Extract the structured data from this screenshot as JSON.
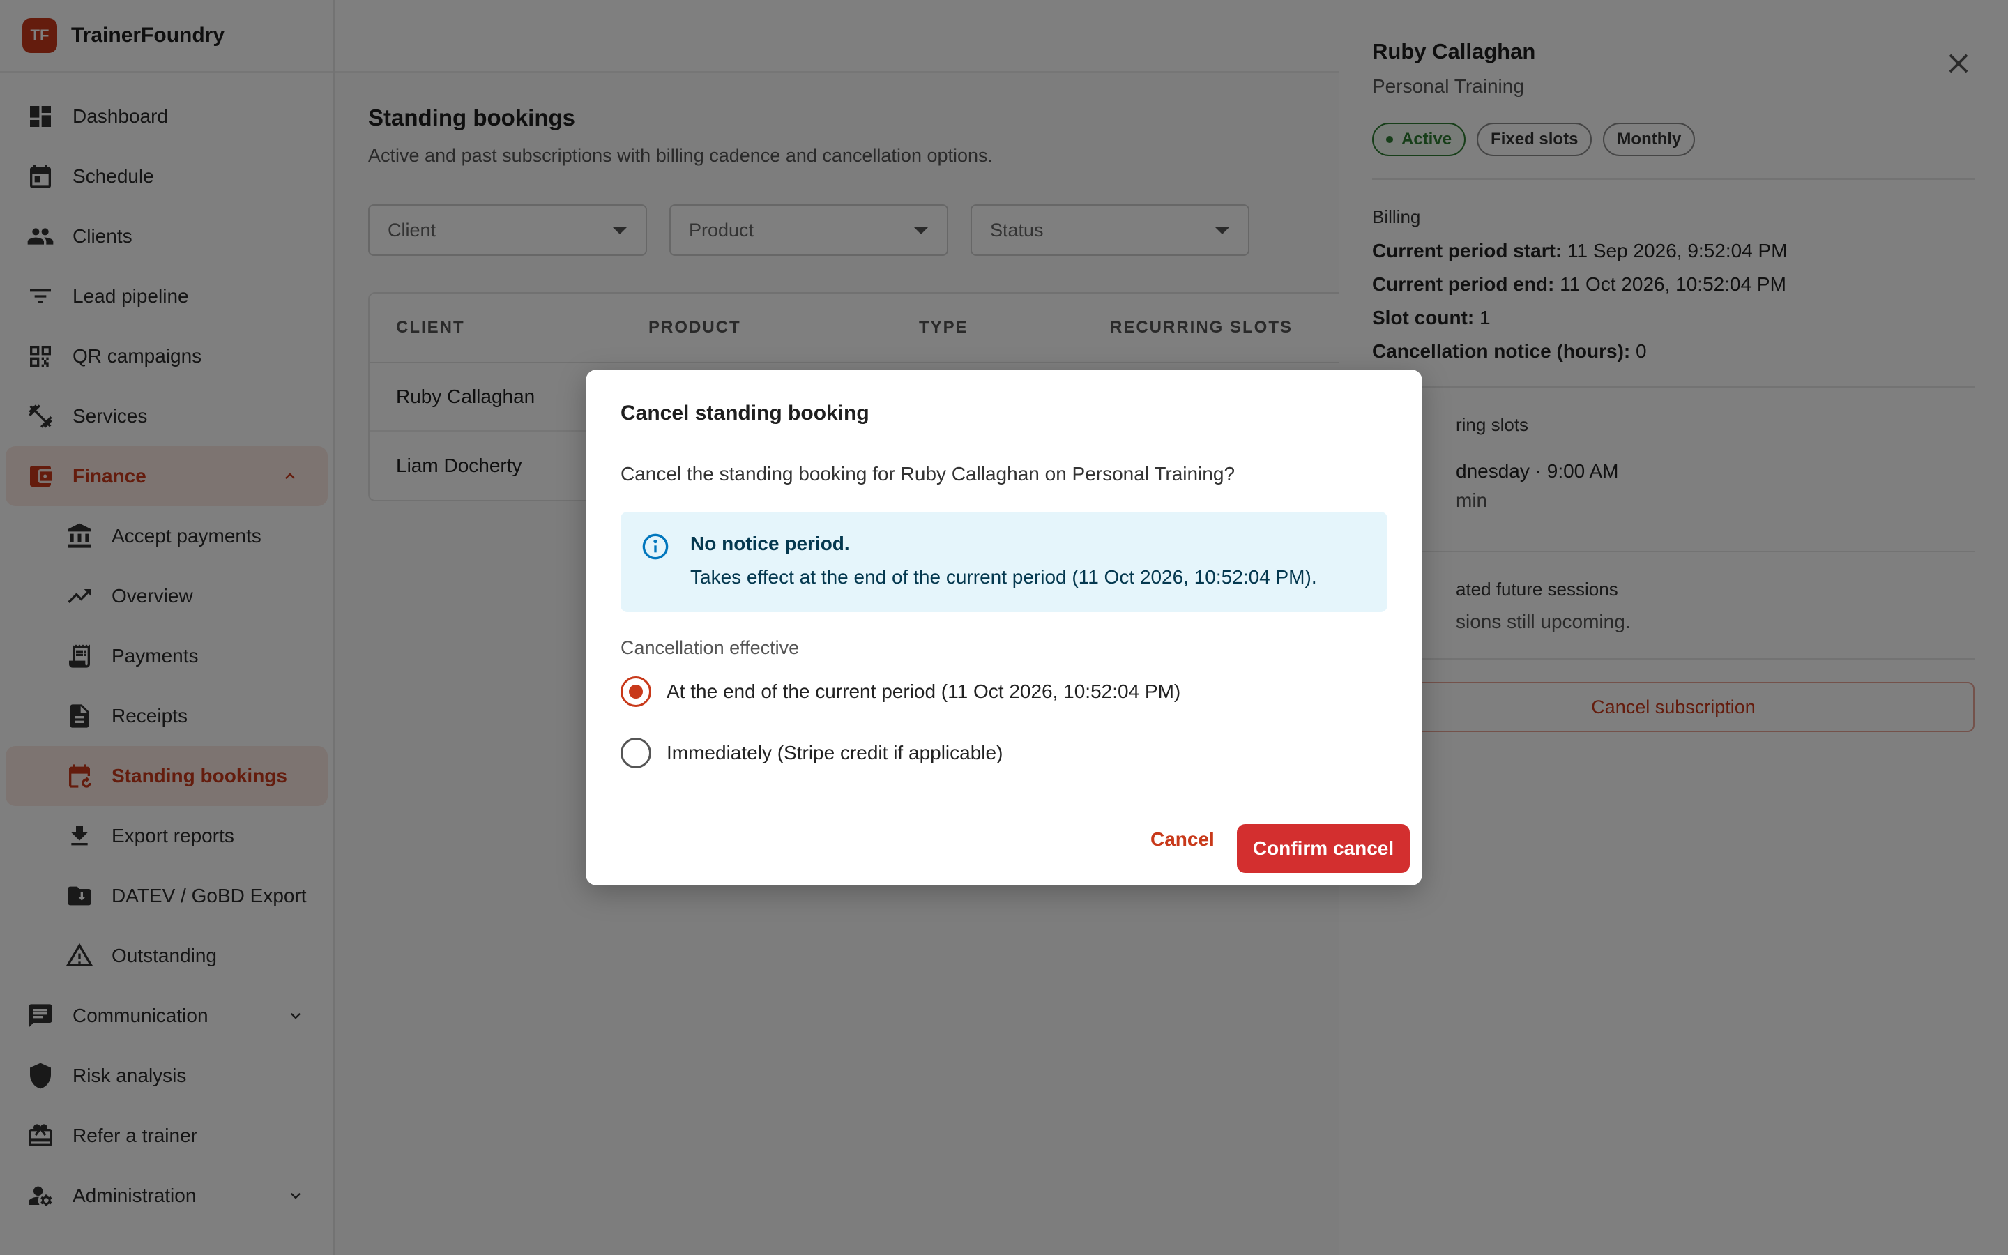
{
  "app": {
    "logo_text": "TF",
    "name": "TrainerFoundry"
  },
  "sidebar": {
    "items": [
      {
        "label": "Dashboard",
        "icon": "dashboard-icon"
      },
      {
        "label": "Schedule",
        "icon": "calendar-icon"
      },
      {
        "label": "Clients",
        "icon": "people-icon"
      },
      {
        "label": "Lead pipeline",
        "icon": "filter-icon"
      },
      {
        "label": "QR campaigns",
        "icon": "qr-icon"
      },
      {
        "label": "Services",
        "icon": "dumbbell-icon"
      },
      {
        "label": "Finance",
        "icon": "wallet-icon"
      },
      {
        "label": "Accept payments",
        "icon": "bank-icon"
      },
      {
        "label": "Overview",
        "icon": "trending-icon"
      },
      {
        "label": "Payments",
        "icon": "receipt-long-icon"
      },
      {
        "label": "Receipts",
        "icon": "document-icon"
      },
      {
        "label": "Standing bookings",
        "icon": "calendar-repeat-icon"
      },
      {
        "label": "Export reports",
        "icon": "download-icon"
      },
      {
        "label": "DATEV / GoBD Export",
        "icon": "folder-icon"
      },
      {
        "label": "Outstanding",
        "icon": "warning-icon"
      },
      {
        "label": "Communication",
        "icon": "chat-icon"
      },
      {
        "label": "Risk analysis",
        "icon": "shield-icon"
      },
      {
        "label": "Refer a trainer",
        "icon": "gift-icon"
      },
      {
        "label": "Administration",
        "icon": "admin-icon"
      }
    ]
  },
  "page": {
    "title": "Standing bookings",
    "subtitle": "Active and past subscriptions with billing cadence and cancellation options.",
    "filters": {
      "client": "Client",
      "product": "Product",
      "status": "Status"
    },
    "table": {
      "headers": [
        "CLIENT",
        "PRODUCT",
        "TYPE",
        "RECURRING SLOTS"
      ],
      "rows": [
        {
          "client": "Ruby Callaghan"
        },
        {
          "client": "Liam Docherty"
        }
      ]
    }
  },
  "drawer": {
    "name": "Ruby Callaghan",
    "product": "Personal Training",
    "chips": {
      "status": "Active",
      "slot_type": "Fixed slots",
      "cadence": "Monthly"
    },
    "billing": {
      "label": "Billing",
      "period_start_label": "Current period start:",
      "period_start_value": "11 Sep 2026, 9:52:04 PM",
      "period_end_label": "Current period end:",
      "period_end_value": "11 Oct 2026, 10:52:04 PM",
      "slot_count_label": "Slot count:",
      "slot_count_value": "1",
      "notice_label": "Cancellation notice (hours):",
      "notice_value": "0"
    },
    "recurring": {
      "label": "ring slots",
      "day": "dnesday · 9:00 AM",
      "duration": "min"
    },
    "future": {
      "label": "ated future sessions",
      "text": "sions still upcoming."
    },
    "cancel_button": "Cancel subscription"
  },
  "modal": {
    "title": "Cancel standing booking",
    "question": "Cancel the standing booking for Ruby Callaghan on Personal Training?",
    "alert_title": "No notice period.",
    "alert_text": "Takes effect at the end of the current period (11 Oct 2026, 10:52:04 PM).",
    "effective_label": "Cancellation effective",
    "option_end": "At the end of the current period (11 Oct 2026, 10:52:04 PM)",
    "option_immediate": "Immediately (Stripe credit if applicable)",
    "cancel_label": "Cancel",
    "confirm_label": "Confirm cancel"
  },
  "colors": {
    "accent": "#c8391a",
    "danger": "#d32f2f",
    "info_bg": "#e5f5fb",
    "success": "#2e7d32"
  }
}
